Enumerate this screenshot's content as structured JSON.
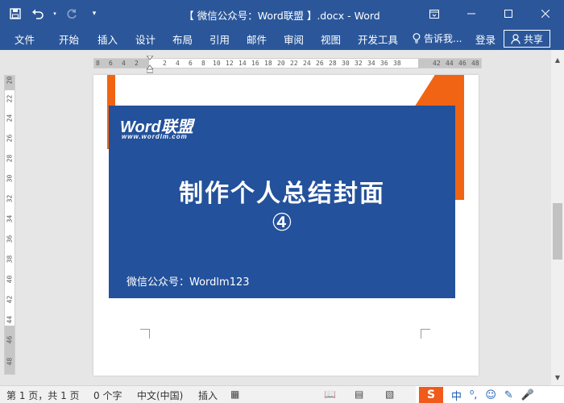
{
  "app": {
    "title": "【 微信公众号：Word联盟 】.docx - Word"
  },
  "qat": {
    "save_icon": "save-icon",
    "undo_icon": "undo-icon",
    "redo_icon": "redo-icon",
    "customize_icon": "customize-qat-icon"
  },
  "window": {
    "restore_ribbon_icon": "ribbon-display-icon",
    "minimize_icon": "minimize-icon",
    "maximize_icon": "maximize-icon",
    "close_icon": "close-icon"
  },
  "ribbon": {
    "tabs": [
      "文件",
      "开始",
      "插入",
      "设计",
      "布局",
      "引用",
      "邮件",
      "审阅",
      "视图",
      "开发工具"
    ],
    "tell_me": "告诉我...",
    "login": "登录",
    "share": "共享"
  },
  "ruler": {
    "ticks": [
      "8",
      "6",
      "4",
      "2",
      "2",
      "4",
      "6",
      "8",
      "10",
      "12",
      "14",
      "16",
      "18",
      "20",
      "22",
      "24",
      "26",
      "28",
      "30",
      "32",
      "34",
      "36",
      "38",
      "42",
      "44",
      "46",
      "48"
    ],
    "vticks": [
      "20",
      "22",
      "24",
      "26",
      "28",
      "30",
      "32",
      "34",
      "36",
      "38",
      "40",
      "42",
      "44",
      "46",
      "48"
    ]
  },
  "cover": {
    "logo": "Word联盟",
    "logo_url": "www.wordlm.com",
    "title": "制作个人总结封面",
    "number": "④",
    "footer": "微信公众号：Wordlm123"
  },
  "status": {
    "page": "第 1 页，共 1 页",
    "words": "0 个字",
    "language": "中文(中国)",
    "insert": "插入"
  },
  "ime": {
    "logo": "S",
    "items": [
      "中",
      "⁰,",
      "☺",
      "✎",
      "🎤"
    ]
  },
  "colors": {
    "ribbon_blue": "#2b579a",
    "cover_blue": "#23519b",
    "cover_orange": "#f06414"
  }
}
